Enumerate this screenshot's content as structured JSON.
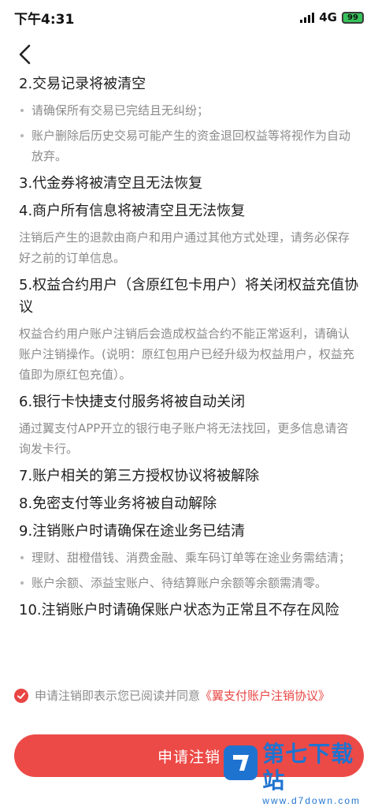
{
  "status_bar": {
    "time": "下午4:31",
    "network": "4G",
    "battery": "99"
  },
  "nav": {
    "back_icon": "chevron-left-icon"
  },
  "sections": [
    {
      "title": "2.交易记录将被清空",
      "bullets": [
        "请确保所有交易已完结且无纠纷；",
        "账户删除后历史交易可能产生的资金退回权益等将视作为自动放弃。"
      ]
    },
    {
      "title": "3.代金券将被清空且无法恢复"
    },
    {
      "title": "4.商户所有信息将被清空且无法恢复",
      "desc": "注销后产生的退款由商户和用户通过其他方式处理，请务必保存好之前的订单信息。"
    },
    {
      "title": "5.权益合约用户（含原红包卡用户）将关闭权益充值协议",
      "desc": "权益合约用户账户注销后会造成权益合约不能正常返利，请确认账户注销操作。(说明：原红包用户已经升级为权益用户，权益充值即为原红包充值）。"
    },
    {
      "title": "6.银行卡快捷支付服务将被自动关闭",
      "desc": "通过翼支付APP开立的银行电子账户将无法找回，更多信息请咨询发卡行。"
    },
    {
      "title": "7.账户相关的第三方授权协议将被解除"
    },
    {
      "title": "8.免密支付等业务将被自动解除"
    },
    {
      "title": "9.注销账户时请确保在途业务已结清",
      "bullets": [
        "理财、甜橙借钱、消费金融、乘车码订单等在途业务需结清；",
        "账户余额、添益宝账户、待结算账户余额等余额需清零。"
      ]
    },
    {
      "title": "10.注销账户时请确保账户状态为正常且不存在风险"
    }
  ],
  "agreement": {
    "text": "申请注销即表示您已阅读并同意",
    "link": "《翼支付账户注销协议》",
    "checked": true
  },
  "submit_label": "申请注销",
  "watermark": {
    "name": "第七下载站",
    "site": "www.d7down.com"
  },
  "colors": {
    "accent": "#ec4a47",
    "watermark": "#1f73d0"
  }
}
